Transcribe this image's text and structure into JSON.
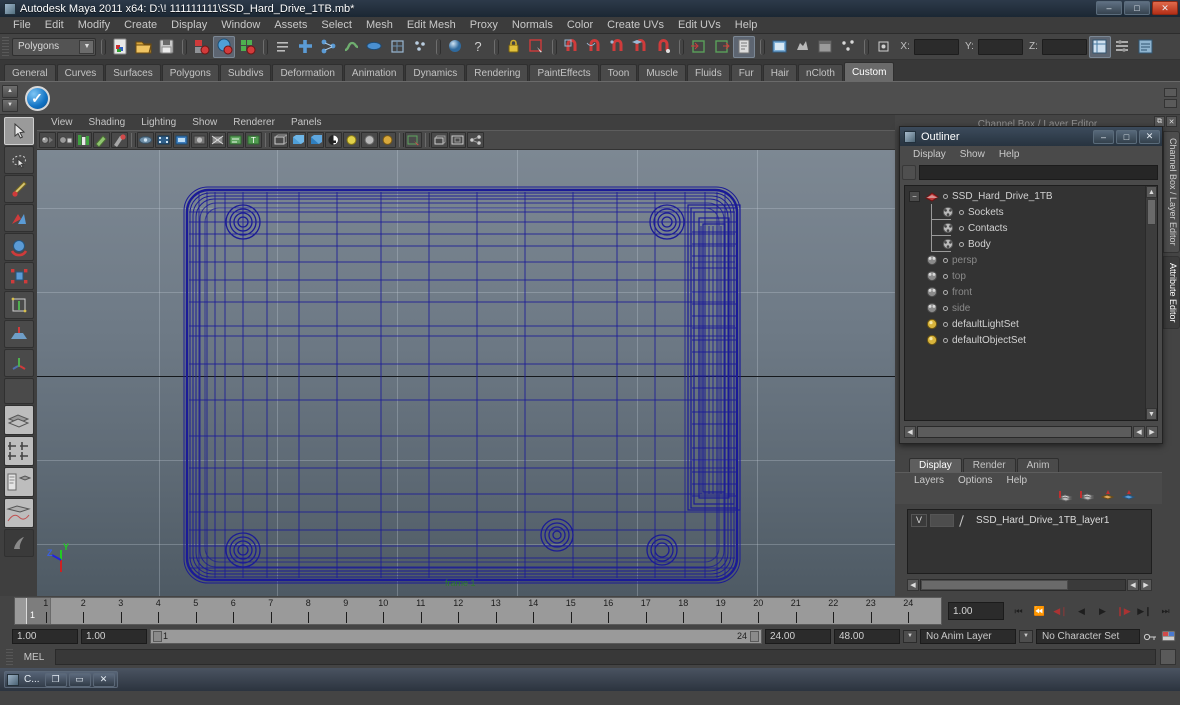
{
  "window": {
    "title": "Autodesk Maya 2011 x64: D:\\! 111111111\\SSD_Hard_Drive_1TB.mb*",
    "minimize": "–",
    "maximize": "□",
    "close": "✕"
  },
  "menubar": {
    "items": [
      "File",
      "Edit",
      "Modify",
      "Create",
      "Display",
      "Window",
      "Assets",
      "Select",
      "Mesh",
      "Edit Mesh",
      "Proxy",
      "Normals",
      "Color",
      "Create UVs",
      "Edit UVs",
      "Help"
    ]
  },
  "statusline": {
    "mode_selector": "Polygons",
    "coord_labels": {
      "x": "X:",
      "y": "Y:",
      "z": "Z:"
    },
    "coord_values": {
      "x": "",
      "y": "",
      "z": ""
    }
  },
  "shelf": {
    "tabs": [
      "General",
      "Curves",
      "Surfaces",
      "Polygons",
      "Subdivs",
      "Deformation",
      "Animation",
      "Dynamics",
      "Rendering",
      "PaintEffects",
      "Toon",
      "Muscle",
      "Fluids",
      "Fur",
      "Hair",
      "nCloth",
      "Custom"
    ],
    "active_tab": "Custom",
    "buttons": [
      {
        "icon": "blue-check-icon",
        "label": ""
      }
    ]
  },
  "viewport": {
    "menus": [
      "View",
      "Shading",
      "Lighting",
      "Show",
      "Renderer",
      "Panels"
    ],
    "axis_gizmo": {
      "x": "X",
      "y": "Y",
      "z": "Z"
    },
    "frame_label": "frame 1",
    "wire_color": "#1b1b96",
    "bg_top": "#7d8893",
    "bg_bottom": "#4e5a64"
  },
  "rightdock": {
    "ghost_panel_title": "Channel Box / Layer Editor",
    "vertical_tabs": [
      "Channel Box / Layer Editor",
      "Attribute Editor"
    ],
    "active_vertical_tab": "Attribute Editor"
  },
  "outliner": {
    "title": "Outliner",
    "window_buttons": {
      "minimize": "–",
      "maximize": "□",
      "close": "✕"
    },
    "menus": [
      "Display",
      "Show",
      "Help"
    ],
    "search_value": "",
    "search_placeholder": "",
    "items": [
      {
        "label": "SSD_Hard_Drive_1TB",
        "indent": 0,
        "icon": "transform-icon",
        "dim": false,
        "expander": "−"
      },
      {
        "label": "Sockets",
        "indent": 1,
        "icon": "mesh-icon",
        "dim": false,
        "expander": ""
      },
      {
        "label": "Contacts",
        "indent": 1,
        "icon": "mesh-icon",
        "dim": false,
        "expander": ""
      },
      {
        "label": "Body",
        "indent": 1,
        "icon": "mesh-icon",
        "dim": false,
        "expander": ""
      },
      {
        "label": "persp",
        "indent": 0,
        "icon": "camera-icon",
        "dim": true,
        "expander": ""
      },
      {
        "label": "top",
        "indent": 0,
        "icon": "camera-icon",
        "dim": true,
        "expander": ""
      },
      {
        "label": "front",
        "indent": 0,
        "icon": "camera-icon",
        "dim": true,
        "expander": ""
      },
      {
        "label": "side",
        "indent": 0,
        "icon": "camera-icon",
        "dim": true,
        "expander": ""
      },
      {
        "label": "defaultLightSet",
        "indent": 0,
        "icon": "set-icon",
        "dim": false,
        "expander": ""
      },
      {
        "label": "defaultObjectSet",
        "indent": 0,
        "icon": "set-icon",
        "dim": false,
        "expander": ""
      }
    ]
  },
  "layereditor": {
    "tabs": [
      "Display",
      "Render",
      "Anim"
    ],
    "active_tab": "Display",
    "menus": [
      "Layers",
      "Options",
      "Help"
    ],
    "layers": [
      {
        "visibility": "V",
        "playback": "",
        "name": "SSD_Hard_Drive_1TB_layer1"
      }
    ]
  },
  "timeslider": {
    "ticks": [
      "1",
      "2",
      "3",
      "4",
      "5",
      "6",
      "7",
      "8",
      "9",
      "10",
      "11",
      "12",
      "13",
      "14",
      "15",
      "16",
      "17",
      "18",
      "19",
      "20",
      "21",
      "22",
      "23",
      "24"
    ],
    "current_frame_marker": "1",
    "current_frame_field": "1.00",
    "playback_buttons": [
      "⏮",
      "⏪",
      "◀❘",
      "◀",
      "▶",
      "❙▶",
      "▶❙",
      "⏭"
    ]
  },
  "rangeslider": {
    "anim_start": "1.00",
    "range_start": "1.00",
    "range_bar_start": "1",
    "range_bar_end": "24",
    "range_end": "24.00",
    "anim_end": "48.00",
    "anim_layer": "No Anim Layer",
    "character_set": "No Character Set"
  },
  "mel": {
    "label": "MEL",
    "value": "",
    "placeholder": ""
  },
  "taskbar": {
    "item_label": "C...",
    "buttons": {
      "restore": "❐",
      "maximize": "▭",
      "close": "✕"
    }
  }
}
